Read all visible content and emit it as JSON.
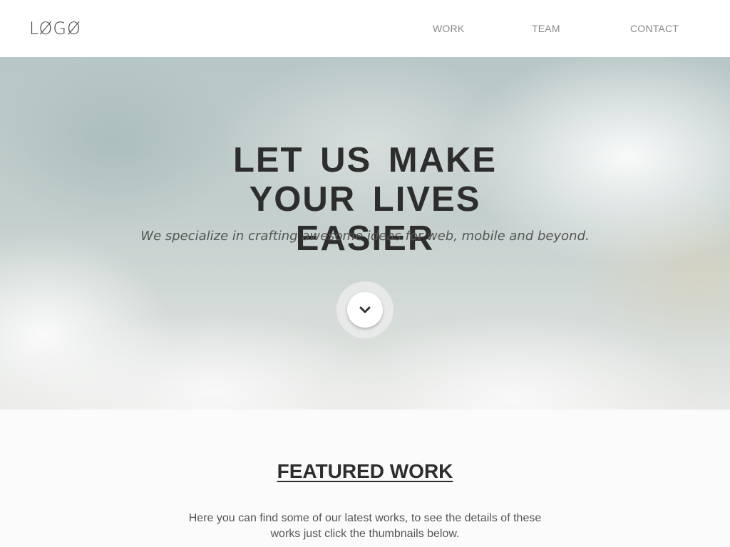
{
  "header": {
    "logo_text": "LØGØ",
    "nav": [
      {
        "label": "WORK"
      },
      {
        "label": "TEAM"
      },
      {
        "label": "CONTACT"
      }
    ]
  },
  "hero": {
    "title": "LET US MAKE YOUR LIVES EASIER",
    "subtitle": "We specialize in crafting awesome ideas for web, mobile and beyond.",
    "scroll_icon": "chevron-down-icon"
  },
  "featured": {
    "title": "FEATURED WORK",
    "description": "Here you can find some of our latest works, to see the details of these works just click the thumbnails below."
  },
  "colors": {
    "heading": "#2d2d2d",
    "nav_text": "#8a8a8a",
    "header_bg": "#ffffff",
    "section_bg": "#fbfbfb"
  }
}
